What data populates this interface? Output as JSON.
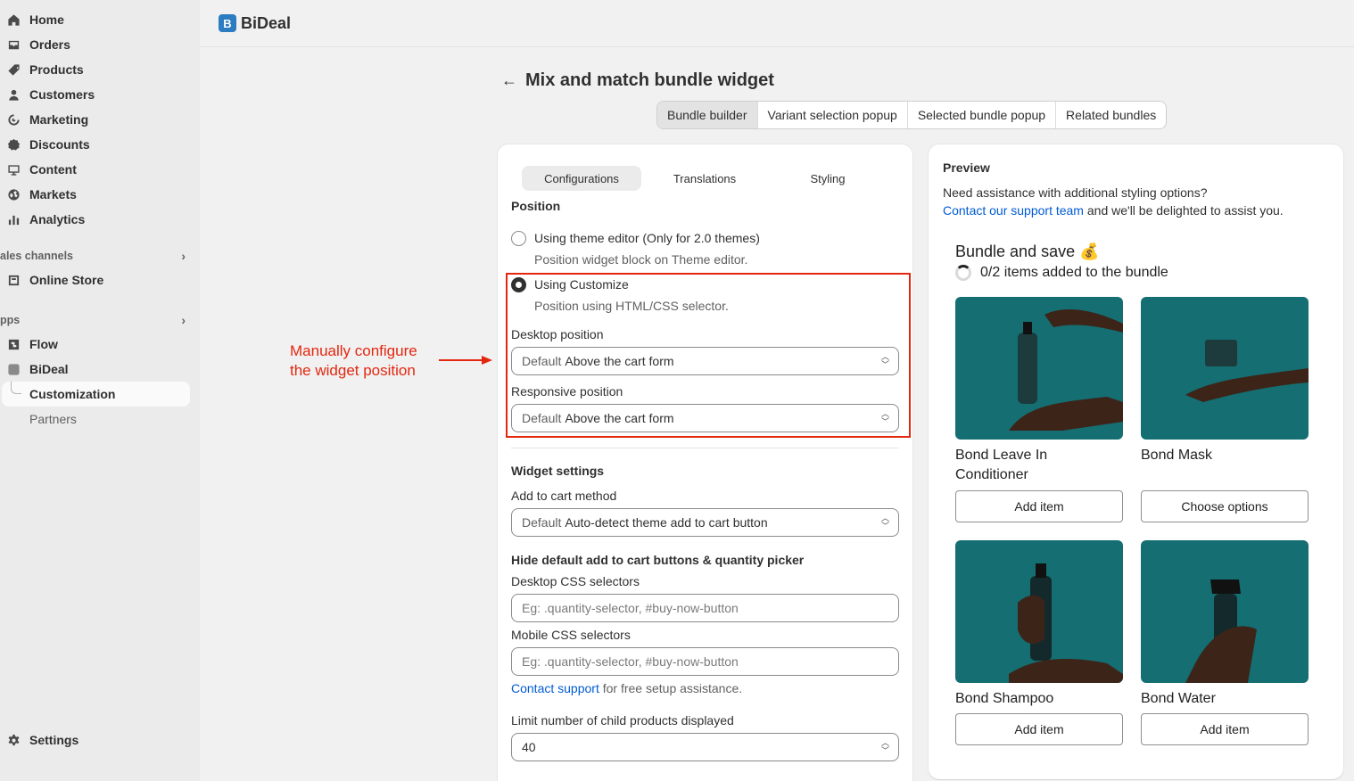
{
  "sidebar": {
    "items": [
      {
        "label": "Home",
        "icon": "home-icon"
      },
      {
        "label": "Orders",
        "icon": "orders-icon"
      },
      {
        "label": "Products",
        "icon": "tag-icon"
      },
      {
        "label": "Customers",
        "icon": "person-icon"
      },
      {
        "label": "Marketing",
        "icon": "target-icon"
      },
      {
        "label": "Discounts",
        "icon": "discount-icon"
      },
      {
        "label": "Content",
        "icon": "content-icon"
      },
      {
        "label": "Markets",
        "icon": "globe-icon"
      },
      {
        "label": "Analytics",
        "icon": "bar-chart-icon"
      }
    ],
    "sales_channels_label": "ales channels",
    "online_store": "Online Store",
    "apps_label": "pps",
    "flow": "Flow",
    "bideal": "BiDeal",
    "customization": "Customization",
    "partners": "Partners",
    "settings": "Settings"
  },
  "topbar": {
    "logo_letter": "B",
    "app_name": "BiDeal"
  },
  "header": {
    "title": "Mix and match bundle widget",
    "tabs": [
      "Bundle builder",
      "Variant selection popup",
      "Selected bundle popup",
      "Related bundles"
    ]
  },
  "config": {
    "subtabs": [
      "Configurations",
      "Translations",
      "Styling"
    ],
    "position_heading": "Position",
    "option1_label": "Using theme editor (Only for 2.0 themes)",
    "option1_help": "Position widget block on Theme editor.",
    "option2_label": "Using Customize",
    "option2_help": "Position using HTML/CSS selector.",
    "desktop_position_label": "Desktop position",
    "desktop_position_prefix": "Default",
    "desktop_position_value": "Above the cart form",
    "responsive_position_label": "Responsive position",
    "responsive_position_prefix": "Default",
    "responsive_position_value": "Above the cart form",
    "widget_settings_heading": "Widget settings",
    "add_to_cart_label": "Add to cart method",
    "add_to_cart_prefix": "Default",
    "add_to_cart_value": "Auto-detect theme add to cart button",
    "hide_heading": "Hide default add to cart buttons & quantity picker",
    "desktop_css_label": "Desktop CSS selectors",
    "desktop_css_placeholder": "Eg: .quantity-selector, #buy-now-button",
    "mobile_css_label": "Mobile CSS selectors",
    "mobile_css_placeholder": "Eg: .quantity-selector, #buy-now-button",
    "contact_link": "Contact support",
    "contact_rest": "for free setup assistance.",
    "limit_label": "Limit number of child products displayed",
    "limit_value": "40"
  },
  "annotation": {
    "line1": "Manually configure",
    "line2": "the widget position",
    "color": "#e3270f"
  },
  "preview": {
    "title": "Preview",
    "assist_text": "Need assistance with additional styling options?",
    "support_link": "Contact our support team",
    "support_rest": "and we'll be delighted to assist you.",
    "bundle_title": "Bundle and save 💰",
    "bundle_progress": "0/2 items added to the bundle",
    "products": [
      {
        "name": "Bond Leave In Conditioner",
        "button": "Add item"
      },
      {
        "name": "Bond Mask",
        "button": "Choose options"
      },
      {
        "name": "Bond Shampoo",
        "button": "Add item"
      },
      {
        "name": "Bond Water",
        "button": "Add item"
      }
    ]
  }
}
